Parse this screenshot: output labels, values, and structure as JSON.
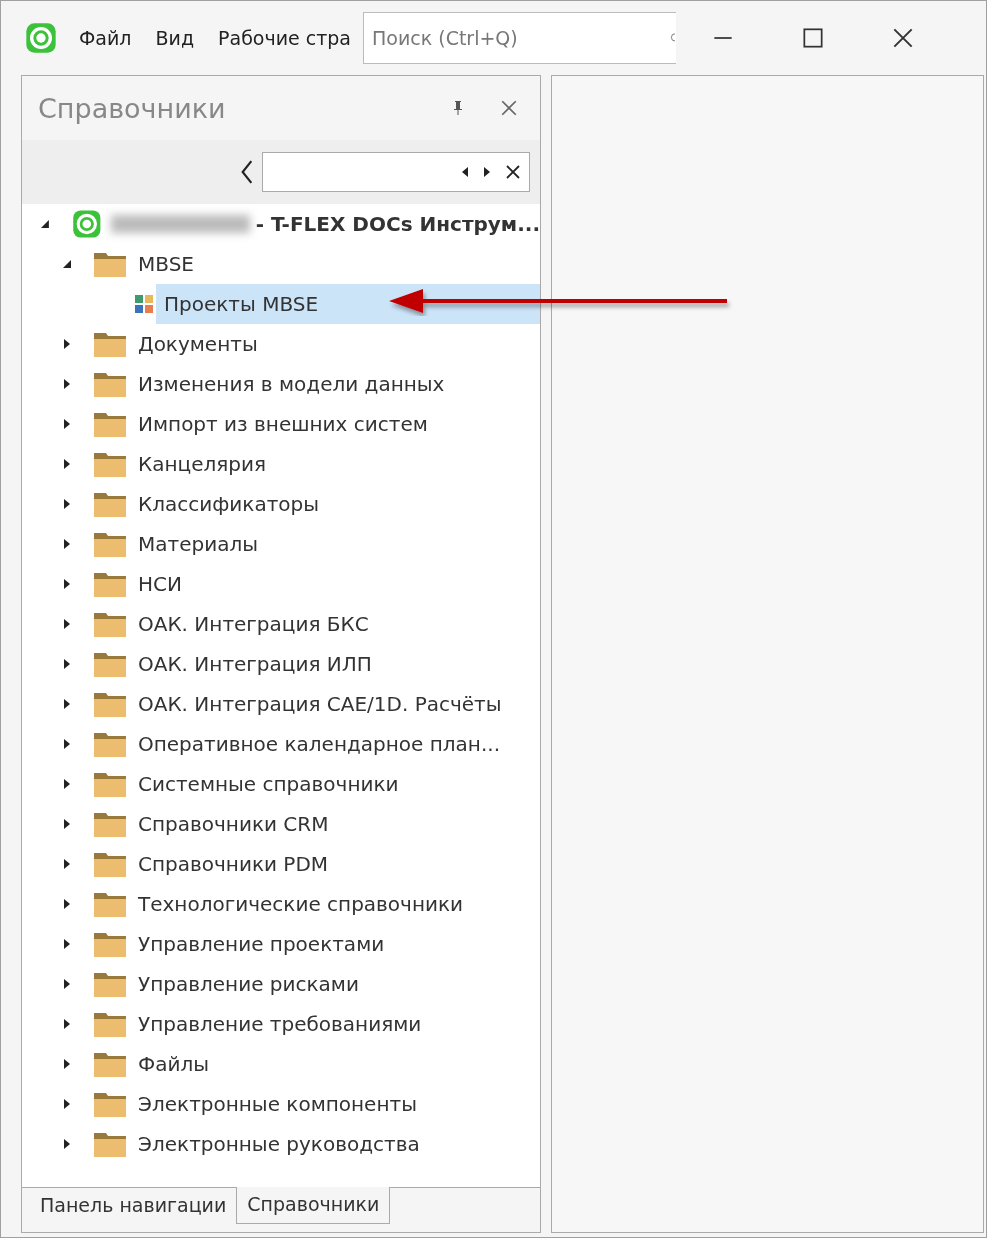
{
  "menu": [
    "Файл",
    "Вид",
    "Рабочие стра"
  ],
  "search": {
    "placeholder": "Поиск (Ctrl+Q)"
  },
  "panel": {
    "title": "Справочники"
  },
  "tree": {
    "label": "- T-FLEX DOCs Инструм...",
    "expanded": true,
    "children": [
      {
        "label": "MBSE",
        "kind": "folder",
        "expanded": true,
        "selected": false,
        "children": [
          {
            "label": "Проекты MBSE",
            "kind": "reference",
            "selected": true
          }
        ]
      },
      {
        "label": "Документы",
        "kind": "folder",
        "expanded": false,
        "selected": false
      },
      {
        "label": "Изменения в модели данных",
        "kind": "folder",
        "expanded": false,
        "selected": false
      },
      {
        "label": "Импорт из внешних систем",
        "kind": "folder",
        "expanded": false,
        "selected": false
      },
      {
        "label": "Канцелярия",
        "kind": "folder",
        "expanded": false,
        "selected": false
      },
      {
        "label": "Классификаторы",
        "kind": "folder",
        "expanded": false,
        "selected": false
      },
      {
        "label": "Материалы",
        "kind": "folder",
        "expanded": false,
        "selected": false
      },
      {
        "label": "НСИ",
        "kind": "folder",
        "expanded": false,
        "selected": false
      },
      {
        "label": "ОАК. Интеграция БКС",
        "kind": "folder",
        "expanded": false,
        "selected": false
      },
      {
        "label": "ОАК. Интеграция ИЛП",
        "kind": "folder",
        "expanded": false,
        "selected": false
      },
      {
        "label": "ОАК. Интеграция САЕ/1D. Расчёты",
        "kind": "folder",
        "expanded": false,
        "selected": false
      },
      {
        "label": "Оперативное календарное план...",
        "kind": "folder",
        "expanded": false,
        "selected": false
      },
      {
        "label": "Системные справочники",
        "kind": "folder",
        "expanded": false,
        "selected": false
      },
      {
        "label": "Справочники CRM",
        "kind": "folder",
        "expanded": false,
        "selected": false
      },
      {
        "label": "Справочники PDM",
        "kind": "folder",
        "expanded": false,
        "selected": false
      },
      {
        "label": "Технологические справочники",
        "kind": "folder",
        "expanded": false,
        "selected": false
      },
      {
        "label": "Управление проектами",
        "kind": "folder",
        "expanded": false,
        "selected": false
      },
      {
        "label": "Управление рисками",
        "kind": "folder",
        "expanded": false,
        "selected": false
      },
      {
        "label": "Управление требованиями",
        "kind": "folder",
        "expanded": false,
        "selected": false
      },
      {
        "label": "Файлы",
        "kind": "folder",
        "expanded": false,
        "selected": false
      },
      {
        "label": "Электронные компоненты",
        "kind": "folder",
        "expanded": false,
        "selected": false
      },
      {
        "label": "Электронные руководства",
        "kind": "folder",
        "expanded": false,
        "selected": false
      }
    ]
  },
  "bottom_tabs": [
    {
      "label": "Панель навигации",
      "selected": false
    },
    {
      "label": "Справочники",
      "selected": true
    }
  ]
}
